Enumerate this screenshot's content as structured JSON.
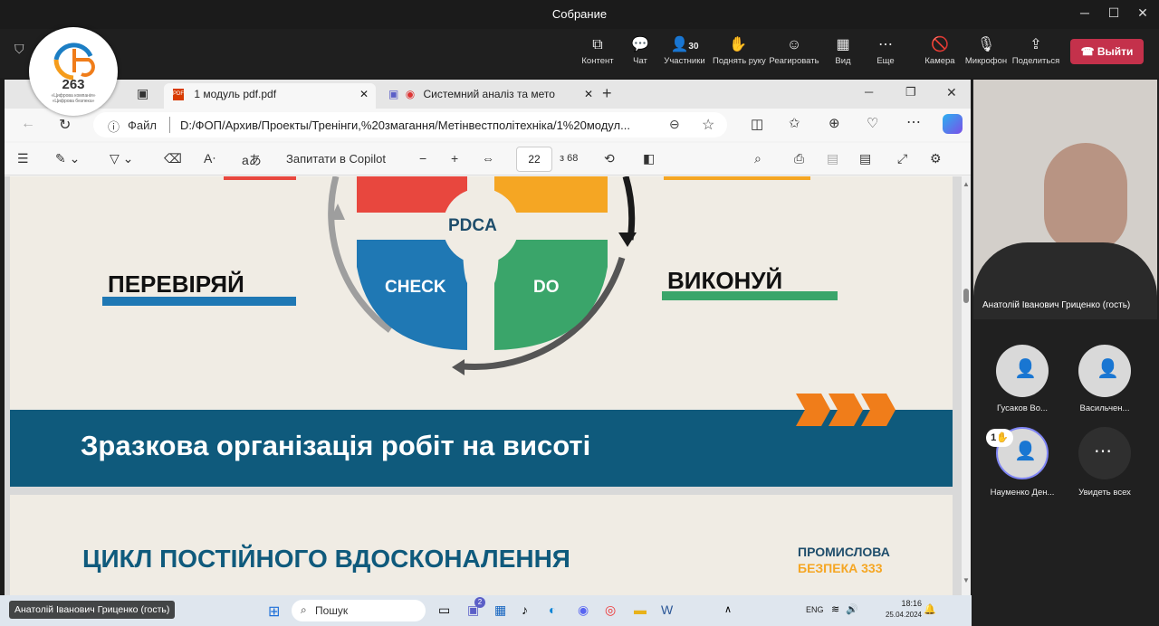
{
  "window": {
    "title": "Собрание"
  },
  "toolbar": {
    "content": "Контент",
    "chat": "Чат",
    "participants": "Участники",
    "participants_count": "30",
    "raise_hand": "Поднять руку",
    "react": "Реагировать",
    "view": "Вид",
    "more": "Еще",
    "camera": "Камера",
    "mic": "Микрофон",
    "share": "Поделиться",
    "leave": "Выйти"
  },
  "logo": {
    "number": "263",
    "subtitle": "«Цифрова компанія» «Цифрова безпека»"
  },
  "browser": {
    "tabs": [
      {
        "title": "1 модуль pdf.pdf"
      },
      {
        "title": "Системний аналіз та мето"
      }
    ],
    "file_label": "Файл",
    "url": "D:/ФОП/Архив/Проекты/Тренінги,%20змагання/Метінвестполітехніка/1%20модул...",
    "copilot_label": "Запитати в Copilot",
    "page_current": "22",
    "page_total": "з 68"
  },
  "slide": {
    "pdca": "PDCA",
    "check": "CHECK",
    "do": "DO",
    "left_label": "ПЕРЕВІРЯЙ",
    "right_label": "ВИКОНУЙ",
    "banner": "Зразкова організація робіт на висоті",
    "next_title": "ЦИКЛ ПОСТІЙНОГО ВДОСКОНАЛЕННЯ",
    "brand_top": "ПРОМИСЛОВА",
    "brand_bottom": "БЕЗПЕКА 333"
  },
  "participants": {
    "speaker": "Анатолій Іванович Гриценко (гость)",
    "list": [
      {
        "name": "Гусаков Во..."
      },
      {
        "name": "Васильчен..."
      },
      {
        "name": "Науменко Ден..."
      },
      {
        "name": "Увидеть всех"
      }
    ],
    "hand_badge": "1"
  },
  "taskbar": {
    "search": "Пошук",
    "lang": "ENG",
    "time": "18:16",
    "date": "25.04.2024",
    "badge": "2"
  },
  "colors": {
    "leave": "#c4314b",
    "banner": "#0f5a7c",
    "check": "#1f78b4",
    "do": "#3aa56a",
    "plan": "#e8473e",
    "act": "#f5a623"
  }
}
